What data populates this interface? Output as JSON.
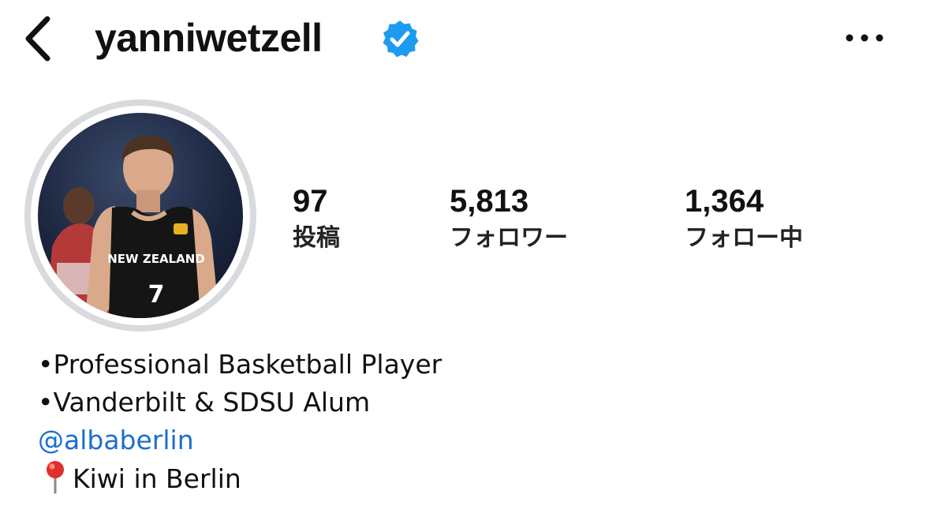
{
  "header": {
    "back_icon": "chevron-left-icon",
    "username": "yanniwetzell",
    "verified_icon": "verified-badge-icon",
    "verified_color": "#1d9bf0",
    "more_icon": "more-horizontal-icon"
  },
  "profile": {
    "avatar_alt": "profile-photo"
  },
  "stats": {
    "posts": {
      "value": "97",
      "label": "投稿"
    },
    "followers": {
      "value": "5,813",
      "label": "フォロワー"
    },
    "following": {
      "value": "1,364",
      "label": "フォロー中"
    }
  },
  "bio": {
    "line1": "•Professional Basketball Player",
    "line2": "•Vanderbilt & SDSU Alum",
    "mention": "@albaberlin",
    "location_icon": "pushpin-icon",
    "location_text": "Kiwi in Berlin",
    "link_color": "#1b6fd0"
  }
}
